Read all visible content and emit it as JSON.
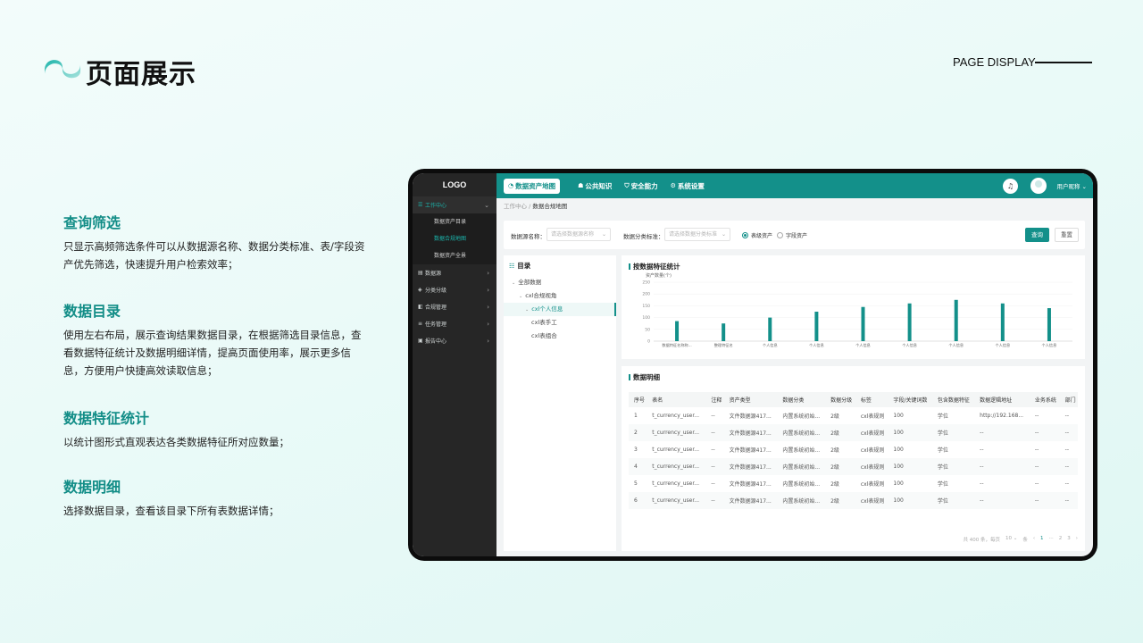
{
  "page": {
    "title": "页面展示",
    "display_label": "PAGE DISPLAY"
  },
  "sections": [
    {
      "title": "查询筛选",
      "body": "只显示高频筛选条件可以从数据源名称、数据分类标准、表/字段资产优先筛选，快速提升用户检索效率；"
    },
    {
      "title": "数据目录",
      "body": "使用左右布局，展示查询结果数据目录，在根据筛选目录信息，查看数据特征统计及数据明细详情，提高页面使用率，展示更多信息，方便用户快捷高效读取信息；"
    },
    {
      "title": "数据特征统计",
      "body": "以统计图形式直观表达各类数据特征所对应数量；"
    },
    {
      "title": "数据明细",
      "body": "选择数据目录，查看该目录下所有表数据详情；"
    }
  ],
  "app": {
    "logo": "LOGO",
    "sidebar": {
      "items": [
        {
          "label": "工作中心",
          "icon": "menu-icon",
          "expanded": true,
          "active": true,
          "children": [
            {
              "label": "数据资产目录"
            },
            {
              "label": "数据合规地图",
              "active": true
            },
            {
              "label": "数据资产全景"
            }
          ]
        },
        {
          "label": "数据源",
          "icon": "database-icon"
        },
        {
          "label": "分类分级",
          "icon": "layers-icon"
        },
        {
          "label": "合规管理",
          "icon": "shield-icon"
        },
        {
          "label": "任务管理",
          "icon": "list-icon"
        },
        {
          "label": "报告中心",
          "icon": "report-icon"
        }
      ]
    },
    "topnav": {
      "items": [
        {
          "label": "数据资产地图",
          "icon": "pie-icon",
          "active": true
        },
        {
          "label": "公共知识",
          "icon": "book-icon"
        },
        {
          "label": "安全能力",
          "icon": "shield-icon"
        },
        {
          "label": "系统设置",
          "icon": "gear-icon"
        }
      ],
      "username": "用户昵称"
    },
    "breadcrumb": {
      "parent": "工作中心",
      "sep": " / ",
      "current": "数据合规地图"
    },
    "filters": {
      "source_label": "数据源名称：",
      "source_placeholder": "请选择数据源名称",
      "standard_label": "数据分类标准：",
      "standard_placeholder": "请选择数据分类标准",
      "radio_table": "表级资产",
      "radio_field": "字段资产",
      "query": "查询",
      "reset": "重置"
    },
    "tree": {
      "title": "目录",
      "nodes": [
        {
          "label": "全部数据",
          "level": 0,
          "toggle": "⌄"
        },
        {
          "label": "cxl合规视角",
          "level": 1,
          "toggle": "⌄"
        },
        {
          "label": "cxl个人信息",
          "level": 2,
          "toggle": "⌄",
          "selected": true
        },
        {
          "label": "cxl表手工",
          "level": 2
        },
        {
          "label": "cxl表组合",
          "level": 2
        }
      ]
    },
    "chart_card_title": "按数据特征统计",
    "table_card_title": "数据明细",
    "table": {
      "headers": [
        "序号",
        "表名",
        "注释",
        "资产类型",
        "数据分类",
        "数据分级",
        "标签",
        "字段/关键词数",
        "包含数据特征",
        "数据逻辑地址",
        "业务系统",
        "部门"
      ],
      "rows": [
        [
          "1",
          "t_currency_user...",
          "--",
          "文件数据源417...",
          "内置系统初始...",
          "2级",
          "cxl表规则",
          "100",
          "学位",
          "http://192.168...",
          "--",
          "--"
        ],
        [
          "2",
          "t_currency_user...",
          "--",
          "文件数据源417...",
          "内置系统初始...",
          "2级",
          "cxl表规则",
          "100",
          "学位",
          "--",
          "--",
          "--"
        ],
        [
          "3",
          "t_currency_user...",
          "--",
          "文件数据源417...",
          "内置系统初始...",
          "2级",
          "cxl表规则",
          "100",
          "学位",
          "--",
          "--",
          "--"
        ],
        [
          "4",
          "t_currency_user...",
          "--",
          "文件数据源417...",
          "内置系统初始...",
          "2级",
          "cxl表规则",
          "100",
          "学位",
          "--",
          "--",
          "--"
        ],
        [
          "5",
          "t_currency_user...",
          "--",
          "文件数据源417...",
          "内置系统初始...",
          "2级",
          "cxl表规则",
          "100",
          "学位",
          "--",
          "--",
          "--"
        ],
        [
          "6",
          "t_currency_user...",
          "--",
          "文件数据源417...",
          "内置系统初始...",
          "2级",
          "cxl表规则",
          "100",
          "学位",
          "--",
          "--",
          "--"
        ]
      ]
    },
    "pager": {
      "total": "共 400 条，每页",
      "size": "10",
      "unit": "条",
      "pages": [
        "1",
        "2",
        "3"
      ],
      "current": "1"
    },
    "colors": {
      "accent": "#13908a",
      "sidebar": "#262626"
    }
  },
  "chart_data": {
    "type": "bar",
    "ylabel": "资产数量(个)",
    "ylim": [
      0,
      250
    ],
    "yticks": [
      0,
      50,
      100,
      150,
      200,
      250
    ],
    "categories": [
      "数据特征名称称...",
      "整理特征名",
      "个人信息",
      "个人信息",
      "个人信息",
      "个人信息",
      "个人信息",
      "个人信息",
      "个人信息"
    ],
    "values": [
      85,
      75,
      100,
      125,
      145,
      160,
      175,
      160,
      140
    ],
    "color": "#13908a"
  }
}
